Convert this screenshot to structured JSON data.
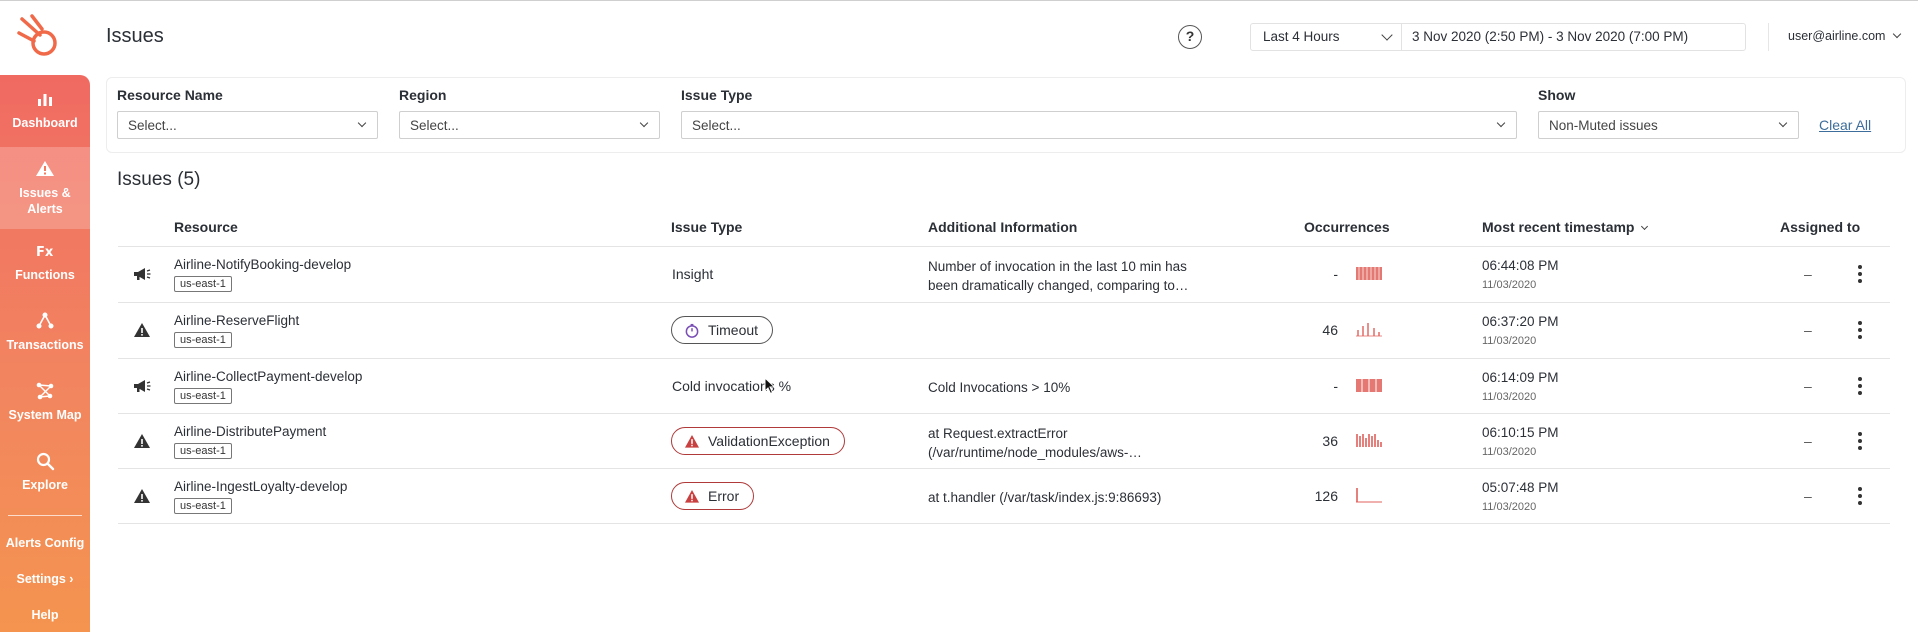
{
  "header": {
    "title": "Issues",
    "help_label": "?",
    "time_preset": "Last 4 Hours",
    "time_range": "3 Nov 2020 (2:50 PM) - 3 Nov 2020 (7:00 PM)",
    "user": "user@airline.com"
  },
  "sidebar": {
    "items": [
      {
        "label": "Dashboard",
        "icon": "bar-chart-icon"
      },
      {
        "label": "Issues & Alerts",
        "icon": "warning-icon"
      },
      {
        "label": "Functions",
        "icon": "fx-icon"
      },
      {
        "label": "Transactions",
        "icon": "nodes-icon"
      },
      {
        "label": "System Map",
        "icon": "map-icon"
      },
      {
        "label": "Explore",
        "icon": "search-icon"
      }
    ],
    "links": {
      "alerts_config": "Alerts Config",
      "settings": "Settings ›",
      "help": "Help"
    }
  },
  "filters": {
    "resource_name": {
      "label": "Resource Name",
      "placeholder": "Select..."
    },
    "region": {
      "label": "Region",
      "placeholder": "Select..."
    },
    "issue_type": {
      "label": "Issue Type",
      "placeholder": "Select..."
    },
    "show": {
      "label": "Show",
      "value": "Non-Muted issues"
    },
    "clear_all": "Clear All"
  },
  "issues": {
    "title": "Issues (5)",
    "columns": {
      "resource": "Resource",
      "issue_type": "Issue Type",
      "additional": "Additional Information",
      "occurrences": "Occurrences",
      "timestamp": "Most recent timestamp",
      "assigned": "Assigned to"
    },
    "rows": [
      {
        "icon": "megaphone-icon",
        "resource": "Airline-NotifyBooking-develop",
        "region": "us-east-1",
        "issue_type": "Insight",
        "issue_style": "text",
        "additional": "Number of invocation in the last 10 min has been dramatically changed, comparing to…",
        "occurrences": "-",
        "time": "06:44:08 PM",
        "date": "11/03/2020",
        "assigned": "–"
      },
      {
        "icon": "warning-icon",
        "resource": "Airline-ReserveFlight",
        "region": "us-east-1",
        "issue_type": "Timeout",
        "issue_style": "pill-timeout",
        "additional": "",
        "occurrences": "46",
        "time": "06:37:20 PM",
        "date": "11/03/2020",
        "assigned": "–"
      },
      {
        "icon": "megaphone-icon",
        "resource": "Airline-CollectPayment-develop",
        "region": "us-east-1",
        "issue_type": "Cold invocations %",
        "issue_style": "text",
        "additional": "Cold Invocations > 10%",
        "occurrences": "-",
        "time": "06:14:09 PM",
        "date": "11/03/2020",
        "assigned": "–"
      },
      {
        "icon": "warning-icon",
        "resource": "Airline-DistributePayment",
        "region": "us-east-1",
        "issue_type": "ValidationException",
        "issue_style": "pill-error",
        "additional": "at Request.extractError (/var/runtime/node_modules/aws-…",
        "occurrences": "36",
        "time": "06:10:15 PM",
        "date": "11/03/2020",
        "assigned": "–"
      },
      {
        "icon": "warning-icon",
        "resource": "Airline-IngestLoyalty-develop",
        "region": "us-east-1",
        "issue_type": "Error",
        "issue_style": "pill-error",
        "additional": "at t.handler (/var/task/index.js:9:86693)",
        "occurrences": "126",
        "time": "05:07:48 PM",
        "date": "11/03/2020",
        "assigned": "–"
      }
    ]
  },
  "colors": {
    "sidebar_top": "#f06a62",
    "sidebar_bottom": "#f4944f",
    "error_border": "#b03a3a",
    "spark": "#e0605b",
    "link": "#3d6d9a"
  }
}
